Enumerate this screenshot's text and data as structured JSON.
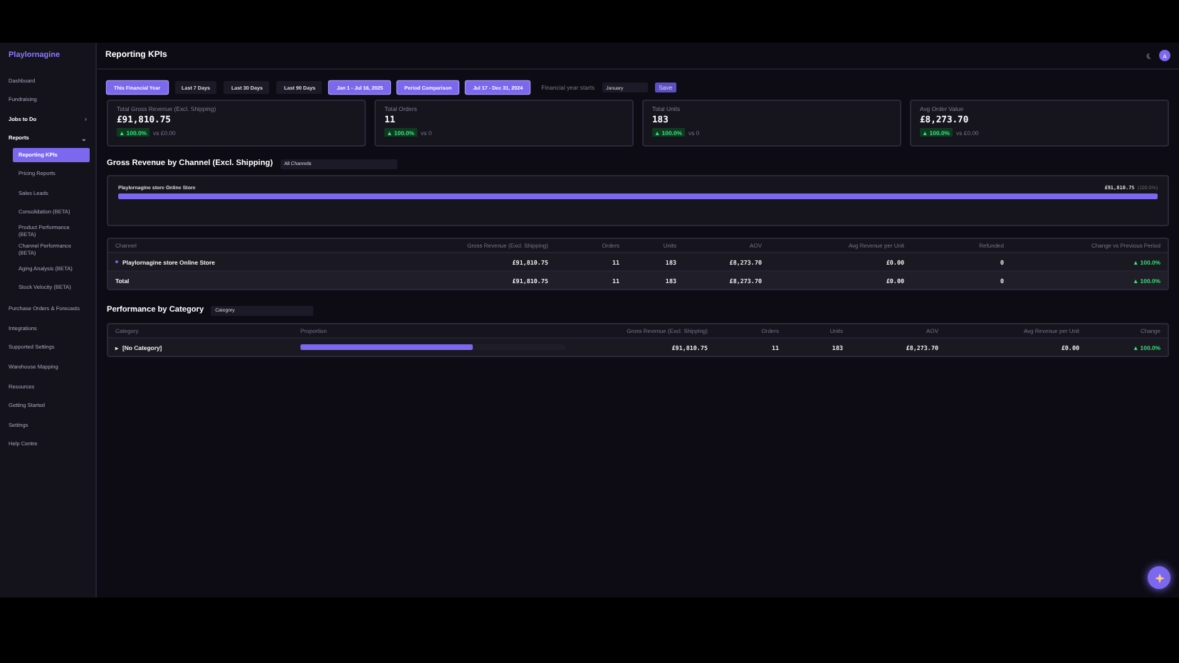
{
  "brand": "Playlornagine",
  "sidebar": {
    "items": [
      {
        "label": "Dashboard",
        "kind": "item"
      },
      {
        "label": "Fundraising",
        "kind": "item"
      },
      {
        "label": "Jobs to Do",
        "kind": "group",
        "expanded": false,
        "caret": "›"
      },
      {
        "label": "Reports",
        "kind": "group",
        "expanded": true,
        "caret": "⌄",
        "children": [
          {
            "label": "Reporting KPIs",
            "selected": true
          },
          {
            "label": "Pricing Reports",
            "selected": false
          },
          {
            "label": "Sales Leads",
            "selected": false
          },
          {
            "label": "Consolidation (BETA)",
            "selected": false
          },
          {
            "label": "Product Performance (BETA)",
            "selected": false
          },
          {
            "label": "Channel Performance (BETA)",
            "selected": false
          },
          {
            "label": "Aging Analysis (BETA)",
            "selected": false
          },
          {
            "label": "Stock Velocity (BETA)",
            "selected": false
          }
        ]
      },
      {
        "label": "Purchase Orders & Forecasts",
        "kind": "item"
      },
      {
        "label": "Integrations",
        "kind": "item"
      },
      {
        "label": "Supported Settings",
        "kind": "item"
      },
      {
        "label": "Warehouse Mapping",
        "kind": "item"
      },
      {
        "label": "Resources",
        "kind": "item"
      },
      {
        "label": "Getting Started",
        "kind": "item"
      },
      {
        "label": "Settings",
        "kind": "item"
      },
      {
        "label": "Help Centre",
        "kind": "item"
      }
    ]
  },
  "page_title": "Reporting KPIs",
  "avatar": "A",
  "filters": [
    {
      "label": "This Financial Year",
      "selected": true
    },
    {
      "label": "Last 7 Days",
      "selected": false
    },
    {
      "label": "Last 30 Days",
      "selected": false
    },
    {
      "label": "Last 90 Days",
      "selected": false
    },
    {
      "label": "Jan 1 - Jul 16, 2025",
      "selected": true
    },
    {
      "label": "Period Comparison",
      "selected": true
    },
    {
      "label": "Jul 17 - Dec 31, 2024",
      "selected": true
    }
  ],
  "fy_label": "Financial year starts",
  "fy_select": "January",
  "fy_button": "Save",
  "kpis": [
    {
      "label": "Total Gross Revenue (Excl. Shipping)",
      "value": "£91,810.75",
      "delta": "▲ 100.0%",
      "compare": "vs £0.00"
    },
    {
      "label": "Total Orders",
      "value": "11",
      "delta": "▲ 100.0%",
      "compare": "vs 0"
    },
    {
      "label": "Total Units",
      "value": "183",
      "delta": "▲ 100.0%",
      "compare": "vs 0"
    },
    {
      "label": "Avg Order Value",
      "value": "£8,273.70",
      "delta": "▲ 100.0%",
      "compare": "vs £0.00"
    }
  ],
  "channel_section": {
    "title": "Gross Revenue by Channel (Excl. Shipping)",
    "select": "All Channels",
    "bars": [
      {
        "label": "Playlornagine store Online Store",
        "value": "£91,810.75",
        "share": "(100.0%)",
        "level": 1
      }
    ],
    "table": {
      "columns": [
        "Channel",
        "Gross Revenue (Excl. Shipping)",
        "Orders",
        "Units",
        "AOV",
        "Avg Revenue per Unit",
        "Refunded",
        "Change vs Previous Period"
      ],
      "rows": [
        {
          "kind": "row",
          "cells": [
            "Playlornagine store Online Store",
            "£91,810.75",
            "11",
            "183",
            "£8,273.70",
            "£0.00",
            "0",
            "▲ 100.0%"
          ]
        },
        {
          "kind": "total",
          "cells": [
            "Total",
            "£91,810.75",
            "11",
            "183",
            "£8,273.70",
            "£0.00",
            "0",
            "▲ 100.0%"
          ]
        }
      ]
    }
  },
  "category_section": {
    "title": "Performance by Category",
    "select": "Category",
    "table": {
      "columns": [
        "Category",
        "Proportion",
        "Gross Revenue (Excl. Shipping)",
        "Orders",
        "Units",
        "AOV",
        "Avg Revenue per Unit",
        "Change"
      ],
      "rows": [
        {
          "caret": "▸",
          "level": 0.65,
          "cells": [
            "[No Category]",
            "",
            "£91,810.75",
            "11",
            "183",
            "£8,273.70",
            "£0.00",
            "▲ 100.0%"
          ]
        }
      ]
    }
  }
}
